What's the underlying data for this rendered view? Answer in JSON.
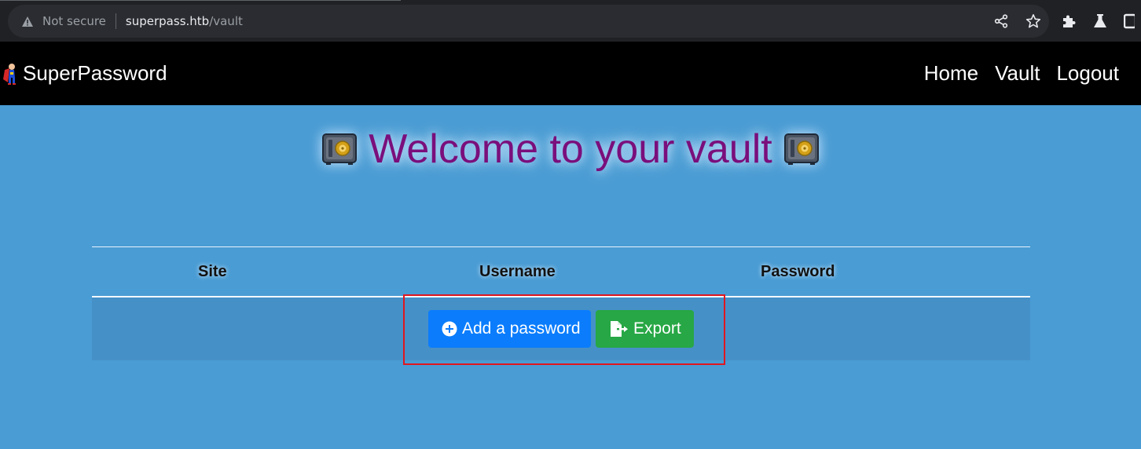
{
  "browser": {
    "security_label": "Not secure",
    "url_host": "superpass.htb",
    "url_path": "/vault"
  },
  "navbar": {
    "brand": "SuperPassword",
    "links": [
      "Home",
      "Vault",
      "Logout"
    ]
  },
  "page": {
    "heading": "Welcome to your vault"
  },
  "table": {
    "headers": [
      "Site",
      "Username",
      "Password"
    ],
    "add_button": "Add a password",
    "export_button": "Export"
  },
  "colors": {
    "background": "#4a9cd4",
    "heading": "#7a0f7c",
    "add_button": "#0b7dfc",
    "export_button": "#27a745",
    "highlight": "#e0161f"
  },
  "icons": [
    "warning-icon",
    "share-icon",
    "star-icon",
    "extensions-icon",
    "labs-icon",
    "superhero-logo-icon",
    "safe-icon",
    "plus-circle-icon",
    "file-export-icon"
  ]
}
